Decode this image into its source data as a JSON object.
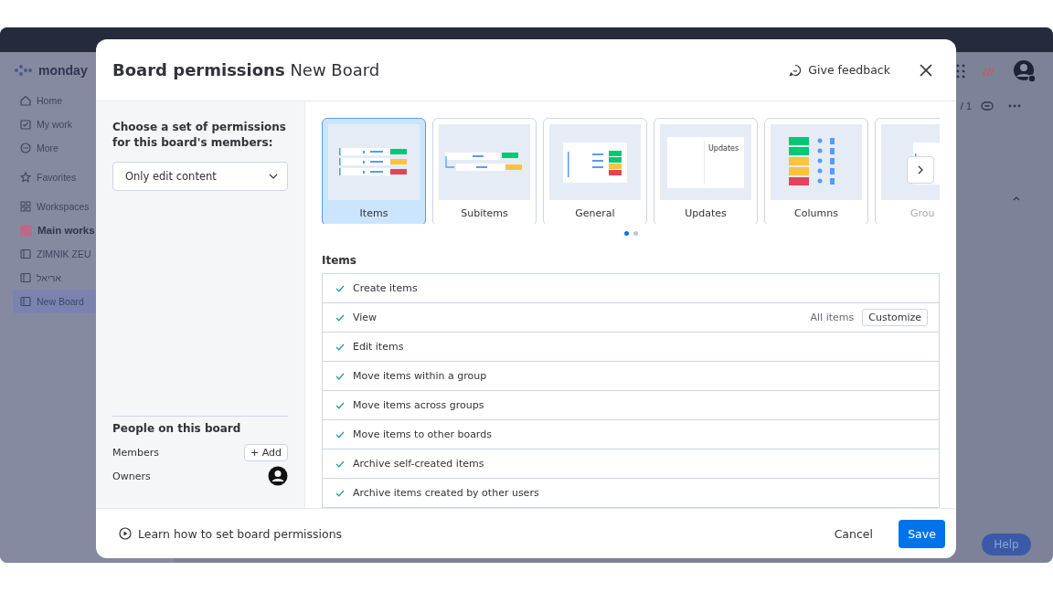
{
  "app": {
    "logo": "monday",
    "sidebar": [
      {
        "label": "Home",
        "selected": false
      },
      {
        "label": "My work",
        "selected": false
      },
      {
        "label": "More",
        "selected": false
      },
      {
        "label": "Favorites",
        "selected": false
      },
      {
        "label": "Workspaces",
        "selected": false
      },
      {
        "label": "Main works",
        "selected": false
      },
      {
        "label": "ZIMNIK ZEU",
        "selected": false
      },
      {
        "label": "אריאל",
        "selected": false
      },
      {
        "label": "New Board",
        "selected": true
      }
    ],
    "pager": "/ 1",
    "help": "Help"
  },
  "modal": {
    "title": "Board permissions",
    "subtitle": "New Board",
    "feedback": "Give feedback",
    "left": {
      "prompt": "Choose a set of permissions for this board's members:",
      "dropdown": "Only edit content",
      "people_title": "People on this board",
      "members": "Members",
      "add": "+ Add",
      "owners": "Owners"
    },
    "cards": [
      {
        "label": "Items",
        "kind": "rows",
        "selected": true
      },
      {
        "label": "Subitems",
        "kind": "subitems",
        "selected": false
      },
      {
        "label": "General",
        "kind": "table",
        "selected": false
      },
      {
        "label": "Updates",
        "kind": "updates",
        "selected": false,
        "thumb_text": "Updates"
      },
      {
        "label": "Columns",
        "kind": "columns",
        "selected": false
      },
      {
        "label": "Grou",
        "kind": "group",
        "selected": false
      }
    ],
    "pages": [
      {
        "selected": true
      },
      {
        "selected": false
      }
    ],
    "section": "Items",
    "permissions": [
      {
        "label": "Create items",
        "checked": true
      },
      {
        "label": "View",
        "checked": true,
        "value": "All items",
        "action": "Customize"
      },
      {
        "label": "Edit items",
        "checked": true
      },
      {
        "label": "Move items within a group",
        "checked": true
      },
      {
        "label": "Move items across groups",
        "checked": true
      },
      {
        "label": "Move items to other boards",
        "checked": true
      },
      {
        "label": "Archive self-created items",
        "checked": true
      },
      {
        "label": "Archive items created by other users",
        "checked": true
      }
    ],
    "footer": {
      "learn": "Learn how to set board permissions",
      "cancel": "Cancel",
      "save": "Save"
    }
  }
}
